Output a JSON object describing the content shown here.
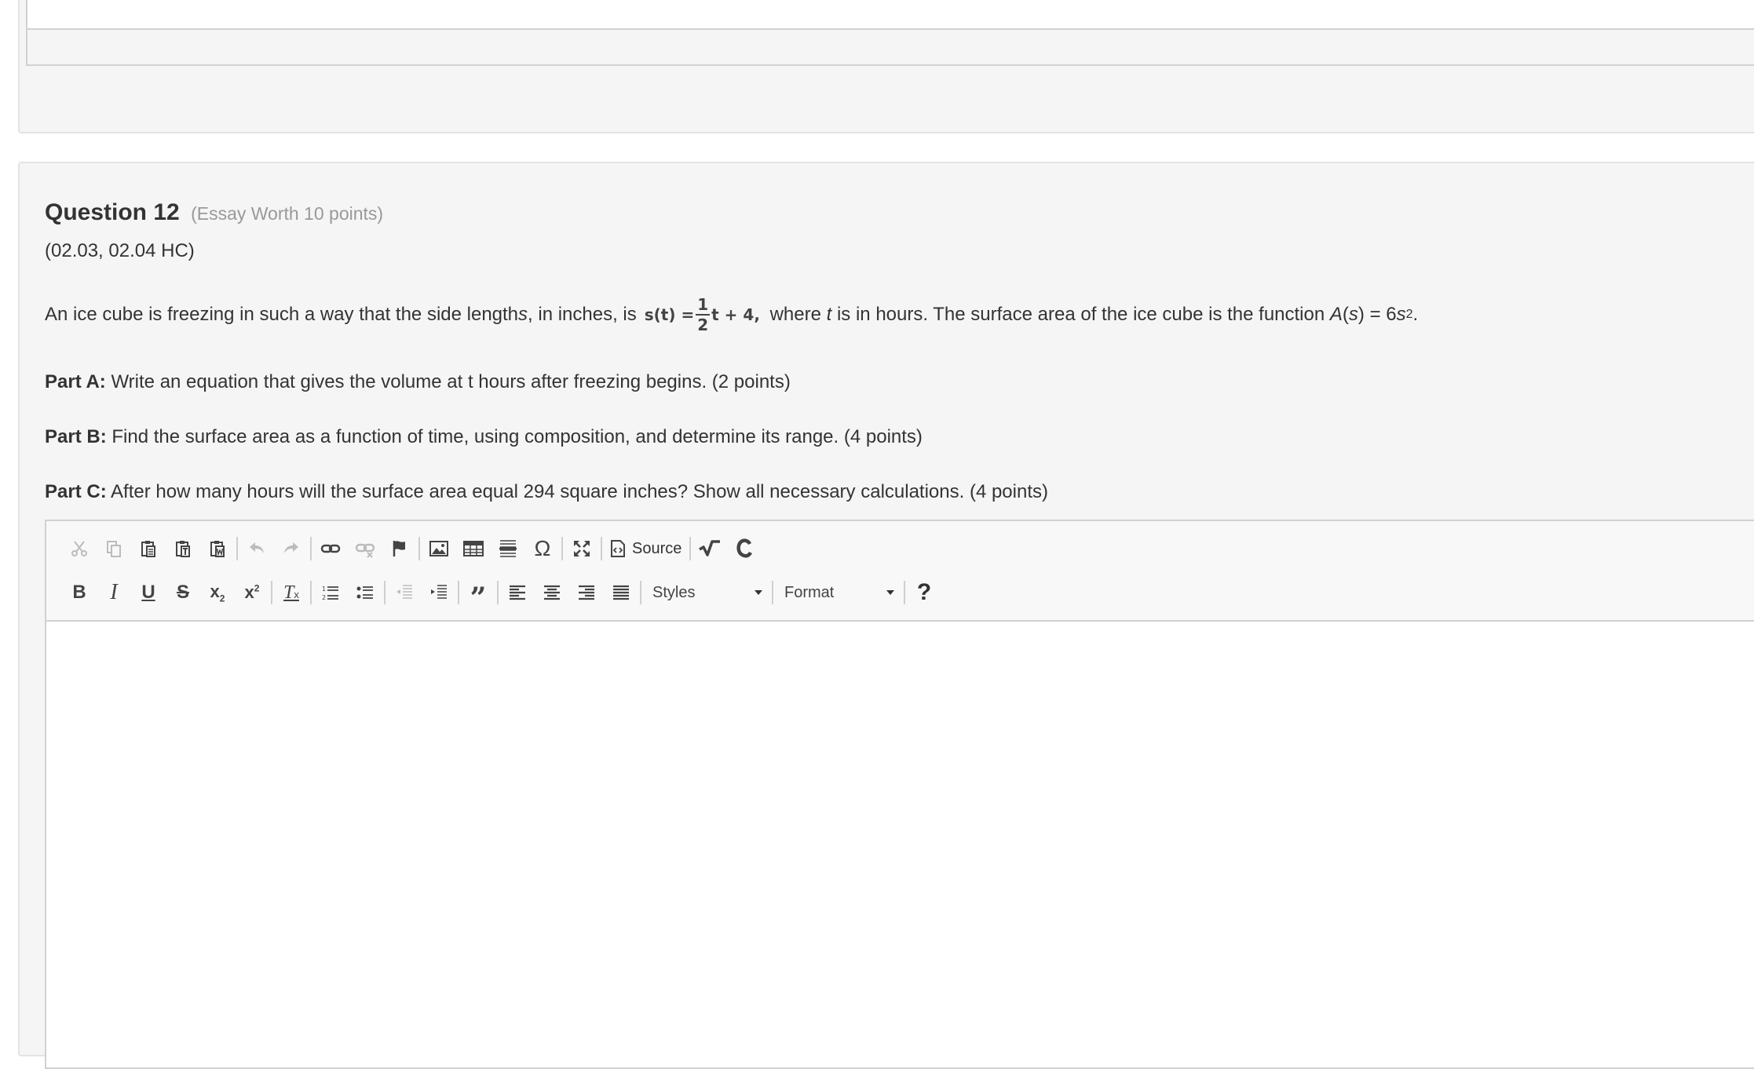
{
  "question": {
    "title": "Question 12",
    "worth": "(Essay Worth 10 points)",
    "standards": "(02.03, 02.04 HC)",
    "body": {
      "text1": "An ice cube is freezing in such a way that the side length ",
      "var_s": "s",
      "text2": ", in inches, is ",
      "math_lhs": "s(t) =",
      "math_num": "1",
      "math_den": "2",
      "math_rhs": "t + 4,",
      "text3": " where ",
      "var_t": "t",
      "text4": " is in hours. The surface area of the ice cube is the function ",
      "func_A": "A",
      "func_open": "(",
      "func_s": "s",
      "func_close": ") = 6",
      "func_s2": "s",
      "exp": "2",
      "period": "."
    },
    "parts": [
      {
        "label": "Part A:",
        "text": " Write an equation that gives the volume at t hours after freezing begins. (2 points)"
      },
      {
        "label": "Part B:",
        "text": " Find the surface area as a function of time, using composition, and determine its range. (4 points)"
      },
      {
        "label": "Part C:",
        "text": " After how many hours will the surface area equal 294 square inches? Show all necessary calculations. (4 points)"
      }
    ]
  },
  "editor": {
    "source_label": "Source",
    "styles_label": "Styles",
    "format_label": "Format",
    "help_label": "?",
    "toolbar_icons": [
      "cut-icon",
      "copy-icon",
      "paste-icon",
      "paste-text-icon",
      "paste-word-icon",
      "undo-icon",
      "redo-icon",
      "link-icon",
      "unlink-icon",
      "anchor-icon",
      "image-icon",
      "table-icon",
      "horizontal-line-icon",
      "special-char-icon",
      "maximize-icon",
      "source-icon",
      "math-icon",
      "chemistry-icon",
      "bold-icon",
      "italic-icon",
      "underline-icon",
      "strikethrough-icon",
      "subscript-icon",
      "superscript-icon",
      "remove-format-icon",
      "numbered-list-icon",
      "bulleted-list-icon",
      "outdent-icon",
      "indent-icon",
      "blockquote-icon",
      "align-left-icon",
      "align-center-icon",
      "align-right-icon",
      "justify-icon"
    ]
  }
}
